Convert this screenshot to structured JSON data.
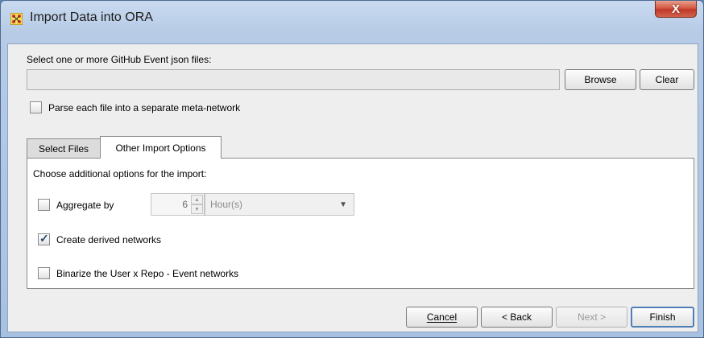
{
  "window": {
    "title": "Import Data into ORA",
    "close_label": "X"
  },
  "file_select": {
    "label": "Select one or more GitHub Event json files:",
    "value": "",
    "browse_label": "Browse",
    "clear_label": "Clear"
  },
  "parse_option": {
    "label": "Parse each file into a separate meta-network",
    "checked": false
  },
  "tabs": [
    {
      "label": "Select Files",
      "active": false
    },
    {
      "label": "Other Import Options",
      "active": true
    }
  ],
  "options_panel": {
    "heading": "Choose additional options for the import:",
    "aggregate": {
      "label": "Aggregate by",
      "checked": false,
      "amount": "6",
      "unit": "Hour(s)"
    },
    "derived": {
      "label": "Create derived networks",
      "checked": true
    },
    "binarize": {
      "label": "Binarize the User x Repo - Event networks",
      "checked": false
    }
  },
  "footer": {
    "cancel_label": "Cancel",
    "back_label": "< Back",
    "next_label": "Next >",
    "finish_label": "Finish"
  },
  "colors": {
    "title_bar": "#b7cbe6",
    "close": "#c0392b",
    "accent": "#4f7fb8",
    "tick": "#23476f"
  }
}
